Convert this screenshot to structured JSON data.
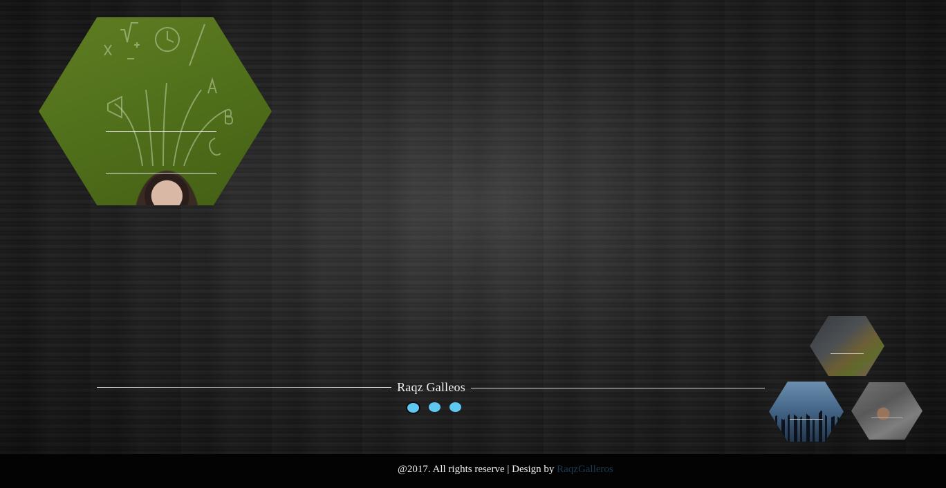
{
  "slider": {
    "title": "Raqz Galleos",
    "dots": [
      {
        "label": "slide-1",
        "active": true
      },
      {
        "label": "slide-2",
        "active": false
      },
      {
        "label": "slide-3",
        "active": false
      }
    ]
  },
  "footer": {
    "copyright": "@2017. All rights reserve | Design by",
    "credit_link": "RaqzGalleros"
  },
  "colors": {
    "dot": "#5fc8f0",
    "footer_bg": "#030303",
    "credit_link": "#1c3a50"
  }
}
